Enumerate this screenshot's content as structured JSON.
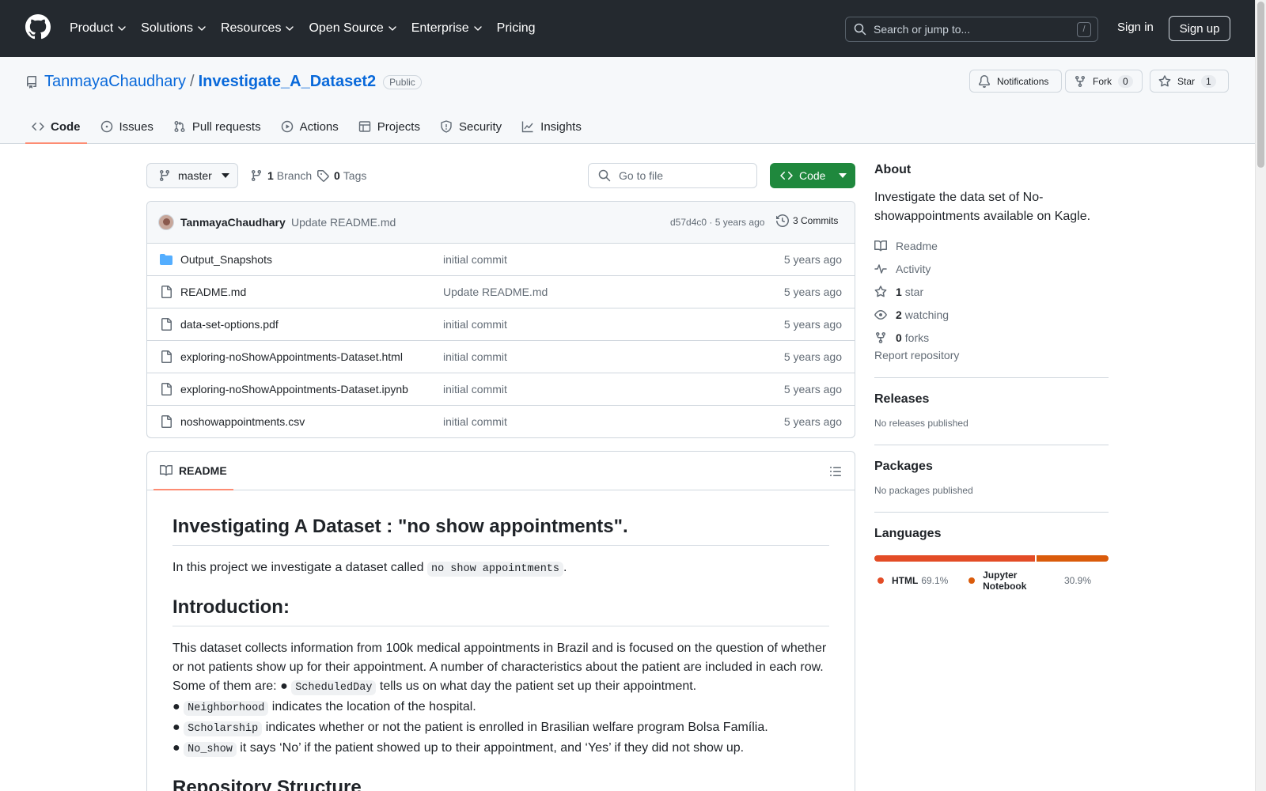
{
  "header": {
    "nav": [
      {
        "label": "Product",
        "dropdown": true
      },
      {
        "label": "Solutions",
        "dropdown": true
      },
      {
        "label": "Resources",
        "dropdown": true
      },
      {
        "label": "Open Source",
        "dropdown": true
      },
      {
        "label": "Enterprise",
        "dropdown": true
      },
      {
        "label": "Pricing",
        "dropdown": false
      }
    ],
    "search_placeholder": "Search or jump to...",
    "search_shortcut": "/",
    "sign_in": "Sign in",
    "sign_up": "Sign up"
  },
  "repo": {
    "owner": "TanmayaChaudhary",
    "separator": "/",
    "name": "Investigate_A_Dataset2",
    "visibility": "Public",
    "notifications_label": "Notifications",
    "fork_label": "Fork",
    "fork_count": "0",
    "star_label": "Star",
    "star_count": "1",
    "tabs": [
      {
        "label": "Code",
        "icon": "code-icon",
        "active": true
      },
      {
        "label": "Issues",
        "icon": "issue-icon",
        "active": false
      },
      {
        "label": "Pull requests",
        "icon": "pull-request-icon",
        "active": false
      },
      {
        "label": "Actions",
        "icon": "play-icon",
        "active": false
      },
      {
        "label": "Projects",
        "icon": "table-icon",
        "active": false
      },
      {
        "label": "Security",
        "icon": "shield-icon",
        "active": false
      },
      {
        "label": "Insights",
        "icon": "graph-icon",
        "active": false
      }
    ]
  },
  "toolbar": {
    "branch": "master",
    "branch_count": "1",
    "branch_label": "Branch",
    "tag_count": "0",
    "tag_label": "Tags",
    "goto_placeholder": "Go to file",
    "code_label": "Code"
  },
  "commit": {
    "author": "TanmayaChaudhary",
    "message": "Update README.md",
    "hash_time": "d57d4c0 · 5 years ago",
    "commits_label": "3 Commits"
  },
  "files": [
    {
      "type": "folder",
      "name": "Output_Snapshots",
      "message": "initial commit",
      "time": "5 years ago"
    },
    {
      "type": "file",
      "name": "README.md",
      "message": "Update README.md",
      "time": "5 years ago"
    },
    {
      "type": "file",
      "name": "data-set-options.pdf",
      "message": "initial commit",
      "time": "5 years ago"
    },
    {
      "type": "file",
      "name": "exploring-noShowAppointments-Dataset.html",
      "message": "initial commit",
      "time": "5 years ago"
    },
    {
      "type": "file",
      "name": "exploring-noShowAppointments-Dataset.ipynb",
      "message": "initial commit",
      "time": "5 years ago"
    },
    {
      "type": "file",
      "name": "noshowappointments.csv",
      "message": "initial commit",
      "time": "5 years ago"
    }
  ],
  "readme": {
    "tab_label": "README",
    "h1": "Investigating A Dataset : \"no show appointments\".",
    "intro_before": "In this project we investigate a dataset called",
    "intro_code": "no show appointments",
    "intro_after": ".",
    "h2_intro": "Introduction:",
    "para": "This dataset collects information from 100k medical appointments in Brazil and is focused on the question of whether or not patients show up for their appointment. A number of characteristics about the patient are included in each row. Some of them are:",
    "bullet": "●",
    "items": [
      {
        "code": "ScheduledDay",
        "text": "tells us on what day the patient set up their appointment."
      },
      {
        "code": "Neighborhood",
        "text": "indicates the location of the hospital."
      },
      {
        "code": "Scholarship",
        "text": "indicates whether or not the patient is enrolled in Brasilian welfare program Bolsa Família."
      },
      {
        "code": "No_show",
        "text": "it says ‘No’ if the patient showed up to their appointment, and ‘Yes’ if they did not show up."
      }
    ],
    "h2_structure": "Repository Structure"
  },
  "sidebar": {
    "about_title": "About",
    "about_text": "Investigate the data set of No-showappointments available on Kagle.",
    "readme": "Readme",
    "activity": "Activity",
    "stars_count": "1",
    "stars_label": "star",
    "watching_count": "2",
    "watching_label": "watching",
    "forks_count": "0",
    "forks_label": "forks",
    "report": "Report repository",
    "releases_title": "Releases",
    "releases_text": "No releases published",
    "packages_title": "Packages",
    "packages_text": "No packages published",
    "languages_title": "Languages",
    "languages": [
      {
        "name": "HTML",
        "percent": "69.1%",
        "value": 69.1,
        "color": "#e34c26"
      },
      {
        "name": "Jupyter Notebook",
        "percent": "30.9%",
        "value": 30.9,
        "color": "#da5b0b"
      }
    ]
  },
  "colors": {
    "header_bg": "#24292f",
    "link": "#0969da",
    "accent_underline": "#fd8c73",
    "code_button": "#1f883d"
  }
}
